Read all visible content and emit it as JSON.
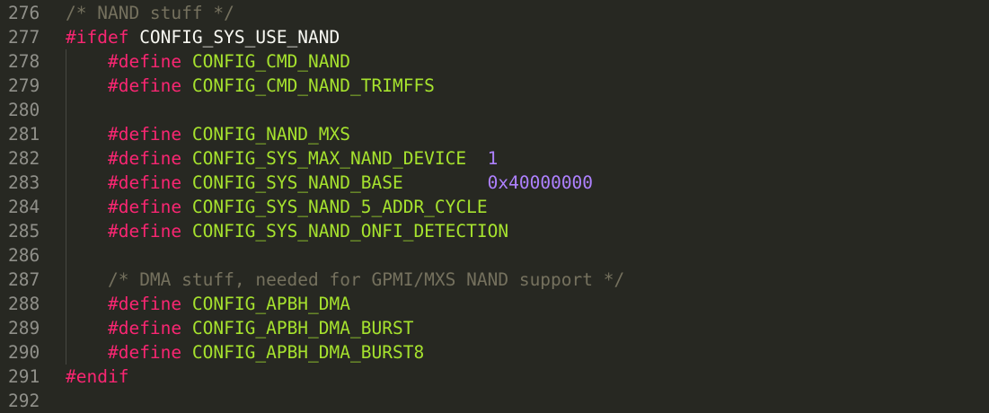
{
  "editor": {
    "theme": {
      "background": "#272822",
      "gutter": "#90908a",
      "comment": "#75715e",
      "keyword": "#f92672",
      "macro": "#a6e22e",
      "number": "#ae81ff",
      "plain": "#f8f8f2"
    },
    "lines": [
      {
        "number": "276",
        "indent": false,
        "tokens": [
          {
            "t": "comment",
            "v": "/* NAND stuff */"
          }
        ]
      },
      {
        "number": "277",
        "indent": false,
        "tokens": [
          {
            "t": "keyword",
            "v": "#ifdef"
          },
          {
            "t": "plain",
            "v": " CONFIG_SYS_USE_NAND"
          }
        ]
      },
      {
        "number": "278",
        "indent": true,
        "tokens": [
          {
            "t": "plain",
            "v": "    "
          },
          {
            "t": "keyword",
            "v": "#define"
          },
          {
            "t": "plain",
            "v": " "
          },
          {
            "t": "macro",
            "v": "CONFIG_CMD_NAND"
          }
        ]
      },
      {
        "number": "279",
        "indent": true,
        "tokens": [
          {
            "t": "plain",
            "v": "    "
          },
          {
            "t": "keyword",
            "v": "#define"
          },
          {
            "t": "plain",
            "v": " "
          },
          {
            "t": "macro",
            "v": "CONFIG_CMD_NAND_TRIMFFS"
          }
        ]
      },
      {
        "number": "280",
        "indent": true,
        "tokens": []
      },
      {
        "number": "281",
        "indent": true,
        "tokens": [
          {
            "t": "plain",
            "v": "    "
          },
          {
            "t": "keyword",
            "v": "#define"
          },
          {
            "t": "plain",
            "v": " "
          },
          {
            "t": "macro",
            "v": "CONFIG_NAND_MXS"
          }
        ]
      },
      {
        "number": "282",
        "indent": true,
        "tokens": [
          {
            "t": "plain",
            "v": "    "
          },
          {
            "t": "keyword",
            "v": "#define"
          },
          {
            "t": "plain",
            "v": " "
          },
          {
            "t": "macro",
            "v": "CONFIG_SYS_MAX_NAND_DEVICE"
          },
          {
            "t": "plain",
            "v": "  "
          },
          {
            "t": "number",
            "v": "1"
          }
        ]
      },
      {
        "number": "283",
        "indent": true,
        "tokens": [
          {
            "t": "plain",
            "v": "    "
          },
          {
            "t": "keyword",
            "v": "#define"
          },
          {
            "t": "plain",
            "v": " "
          },
          {
            "t": "macro",
            "v": "CONFIG_SYS_NAND_BASE"
          },
          {
            "t": "plain",
            "v": "        "
          },
          {
            "t": "number",
            "v": "0x40000000"
          }
        ]
      },
      {
        "number": "284",
        "indent": true,
        "tokens": [
          {
            "t": "plain",
            "v": "    "
          },
          {
            "t": "keyword",
            "v": "#define"
          },
          {
            "t": "plain",
            "v": " "
          },
          {
            "t": "macro",
            "v": "CONFIG_SYS_NAND_5_ADDR_CYCLE"
          }
        ]
      },
      {
        "number": "285",
        "indent": true,
        "tokens": [
          {
            "t": "plain",
            "v": "    "
          },
          {
            "t": "keyword",
            "v": "#define"
          },
          {
            "t": "plain",
            "v": " "
          },
          {
            "t": "macro",
            "v": "CONFIG_SYS_NAND_ONFI_DETECTION"
          }
        ]
      },
      {
        "number": "286",
        "indent": true,
        "tokens": []
      },
      {
        "number": "287",
        "indent": true,
        "tokens": [
          {
            "t": "plain",
            "v": "    "
          },
          {
            "t": "comment",
            "v": "/* DMA stuff, needed for GPMI/MXS NAND support */"
          }
        ]
      },
      {
        "number": "288",
        "indent": true,
        "tokens": [
          {
            "t": "plain",
            "v": "    "
          },
          {
            "t": "keyword",
            "v": "#define"
          },
          {
            "t": "plain",
            "v": " "
          },
          {
            "t": "macro",
            "v": "CONFIG_APBH_DMA"
          }
        ]
      },
      {
        "number": "289",
        "indent": true,
        "tokens": [
          {
            "t": "plain",
            "v": "    "
          },
          {
            "t": "keyword",
            "v": "#define"
          },
          {
            "t": "plain",
            "v": " "
          },
          {
            "t": "macro",
            "v": "CONFIG_APBH_DMA_BURST"
          }
        ]
      },
      {
        "number": "290",
        "indent": true,
        "tokens": [
          {
            "t": "plain",
            "v": "    "
          },
          {
            "t": "keyword",
            "v": "#define"
          },
          {
            "t": "plain",
            "v": " "
          },
          {
            "t": "macro",
            "v": "CONFIG_APBH_DMA_BURST8"
          }
        ]
      },
      {
        "number": "291",
        "indent": false,
        "tokens": [
          {
            "t": "keyword",
            "v": "#endif"
          }
        ]
      },
      {
        "number": "292",
        "indent": false,
        "tokens": []
      }
    ]
  }
}
